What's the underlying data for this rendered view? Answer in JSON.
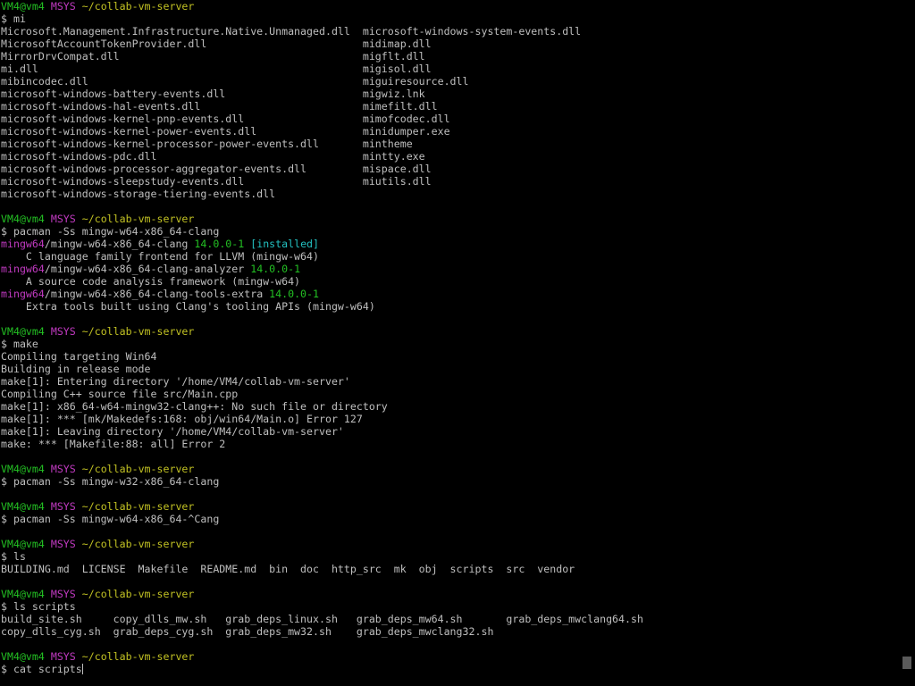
{
  "terminal": {
    "lines": [
      {
        "segs": [
          {
            "t": "VM4@vm4 ",
            "c": "user"
          },
          {
            "t": "MSYS ",
            "c": "sys"
          },
          {
            "t": "~/collab-vm-server",
            "c": "path"
          }
        ]
      },
      {
        "segs": [
          {
            "t": "$ mi",
            "c": "text"
          }
        ]
      },
      {
        "segs": [
          {
            "t": "Microsoft.Management.Infrastructure.Native.Unmanaged.dll  microsoft-windows-system-events.dll",
            "c": "text"
          }
        ]
      },
      {
        "segs": [
          {
            "t": "MicrosoftAccountTokenProvider.dll                         midimap.dll",
            "c": "text"
          }
        ]
      },
      {
        "segs": [
          {
            "t": "MirrorDrvCompat.dll                                       migflt.dll",
            "c": "text"
          }
        ]
      },
      {
        "segs": [
          {
            "t": "mi.dll                                                    migisol.dll",
            "c": "text"
          }
        ]
      },
      {
        "segs": [
          {
            "t": "mibincodec.dll                                            miguiresource.dll",
            "c": "text"
          }
        ]
      },
      {
        "segs": [
          {
            "t": "microsoft-windows-battery-events.dll                      migwiz.lnk",
            "c": "text"
          }
        ]
      },
      {
        "segs": [
          {
            "t": "microsoft-windows-hal-events.dll                          mimefilt.dll",
            "c": "text"
          }
        ]
      },
      {
        "segs": [
          {
            "t": "microsoft-windows-kernel-pnp-events.dll                   mimofcodec.dll",
            "c": "text"
          }
        ]
      },
      {
        "segs": [
          {
            "t": "microsoft-windows-kernel-power-events.dll                 minidumper.exe",
            "c": "text"
          }
        ]
      },
      {
        "segs": [
          {
            "t": "microsoft-windows-kernel-processor-power-events.dll       mintheme",
            "c": "text"
          }
        ]
      },
      {
        "segs": [
          {
            "t": "microsoft-windows-pdc.dll                                 mintty.exe",
            "c": "text"
          }
        ]
      },
      {
        "segs": [
          {
            "t": "microsoft-windows-processor-aggregator-events.dll         mispace.dll",
            "c": "text"
          }
        ]
      },
      {
        "segs": [
          {
            "t": "microsoft-windows-sleepstudy-events.dll                   miutils.dll",
            "c": "text"
          }
        ]
      },
      {
        "segs": [
          {
            "t": "microsoft-windows-storage-tiering-events.dll",
            "c": "text"
          }
        ]
      },
      {
        "segs": []
      },
      {
        "segs": [
          {
            "t": "VM4@vm4 ",
            "c": "user"
          },
          {
            "t": "MSYS ",
            "c": "sys"
          },
          {
            "t": "~/collab-vm-server",
            "c": "path"
          }
        ]
      },
      {
        "segs": [
          {
            "t": "$ pacman -Ss mingw-w64-x86_64-clang",
            "c": "text"
          }
        ]
      },
      {
        "segs": [
          {
            "t": "mingw64",
            "c": "repo"
          },
          {
            "t": "/mingw-w64-x86_64-clang ",
            "c": "text"
          },
          {
            "t": "14.0.0-1 ",
            "c": "ver"
          },
          {
            "t": "[installed]",
            "c": "inst"
          }
        ]
      },
      {
        "segs": [
          {
            "t": "    C language family frontend for LLVM (mingw-w64)",
            "c": "text"
          }
        ]
      },
      {
        "segs": [
          {
            "t": "mingw64",
            "c": "repo"
          },
          {
            "t": "/mingw-w64-x86_64-clang-analyzer ",
            "c": "text"
          },
          {
            "t": "14.0.0-1",
            "c": "ver"
          }
        ]
      },
      {
        "segs": [
          {
            "t": "    A source code analysis framework (mingw-w64)",
            "c": "text"
          }
        ]
      },
      {
        "segs": [
          {
            "t": "mingw64",
            "c": "repo"
          },
          {
            "t": "/mingw-w64-x86_64-clang-tools-extra ",
            "c": "text"
          },
          {
            "t": "14.0.0-1",
            "c": "ver"
          }
        ]
      },
      {
        "segs": [
          {
            "t": "    Extra tools built using Clang's tooling APIs (mingw-w64)",
            "c": "text"
          }
        ]
      },
      {
        "segs": []
      },
      {
        "segs": [
          {
            "t": "VM4@vm4 ",
            "c": "user"
          },
          {
            "t": "MSYS ",
            "c": "sys"
          },
          {
            "t": "~/collab-vm-server",
            "c": "path"
          }
        ]
      },
      {
        "segs": [
          {
            "t": "$ make",
            "c": "text"
          }
        ]
      },
      {
        "segs": [
          {
            "t": "Compiling targeting Win64",
            "c": "text"
          }
        ]
      },
      {
        "segs": [
          {
            "t": "Building in release mode",
            "c": "text"
          }
        ]
      },
      {
        "segs": [
          {
            "t": "make[1]: Entering directory '/home/VM4/collab-vm-server'",
            "c": "text"
          }
        ]
      },
      {
        "segs": [
          {
            "t": "Compiling C++ source file src/Main.cpp",
            "c": "text"
          }
        ]
      },
      {
        "segs": [
          {
            "t": "make[1]: x86_64-w64-mingw32-clang++: No such file or directory",
            "c": "text"
          }
        ]
      },
      {
        "segs": [
          {
            "t": "make[1]: *** [mk/Makedefs:168: obj/win64/Main.o] Error 127",
            "c": "text"
          }
        ]
      },
      {
        "segs": [
          {
            "t": "make[1]: Leaving directory '/home/VM4/collab-vm-server'",
            "c": "text"
          }
        ]
      },
      {
        "segs": [
          {
            "t": "make: *** [Makefile:88: all] Error 2",
            "c": "text"
          }
        ]
      },
      {
        "segs": []
      },
      {
        "segs": [
          {
            "t": "VM4@vm4 ",
            "c": "user"
          },
          {
            "t": "MSYS ",
            "c": "sys"
          },
          {
            "t": "~/collab-vm-server",
            "c": "path"
          }
        ]
      },
      {
        "segs": [
          {
            "t": "$ pacman -Ss mingw-w32-x86_64-clang",
            "c": "text"
          }
        ]
      },
      {
        "segs": []
      },
      {
        "segs": [
          {
            "t": "VM4@vm4 ",
            "c": "user"
          },
          {
            "t": "MSYS ",
            "c": "sys"
          },
          {
            "t": "~/collab-vm-server",
            "c": "path"
          }
        ]
      },
      {
        "segs": [
          {
            "t": "$ pacman -Ss mingw-w64-x86_64-^Cang",
            "c": "text"
          }
        ]
      },
      {
        "segs": []
      },
      {
        "segs": [
          {
            "t": "VM4@vm4 ",
            "c": "user"
          },
          {
            "t": "MSYS ",
            "c": "sys"
          },
          {
            "t": "~/collab-vm-server",
            "c": "path"
          }
        ]
      },
      {
        "segs": [
          {
            "t": "$ ls",
            "c": "text"
          }
        ]
      },
      {
        "segs": [
          {
            "t": "BUILDING.md  LICENSE  Makefile  README.md  bin  doc  http_src  mk  obj  scripts  src  vendor",
            "c": "text"
          }
        ]
      },
      {
        "segs": []
      },
      {
        "segs": [
          {
            "t": "VM4@vm4 ",
            "c": "user"
          },
          {
            "t": "MSYS ",
            "c": "sys"
          },
          {
            "t": "~/collab-vm-server",
            "c": "path"
          }
        ]
      },
      {
        "segs": [
          {
            "t": "$ ls scripts",
            "c": "text"
          }
        ]
      },
      {
        "segs": [
          {
            "t": "build_site.sh     copy_dlls_mw.sh   grab_deps_linux.sh   grab_deps_mw64.sh       grab_deps_mwclang64.sh",
            "c": "text"
          }
        ]
      },
      {
        "segs": [
          {
            "t": "copy_dlls_cyg.sh  grab_deps_cyg.sh  grab_deps_mw32.sh    grab_deps_mwclang32.sh",
            "c": "text"
          }
        ]
      },
      {
        "segs": []
      },
      {
        "segs": [
          {
            "t": "VM4@vm4 ",
            "c": "user"
          },
          {
            "t": "MSYS ",
            "c": "sys"
          },
          {
            "t": "~/collab-vm-server",
            "c": "path"
          }
        ]
      },
      {
        "segs": [
          {
            "t": "$ cat scripts",
            "c": "text"
          }
        ],
        "cursor": true
      }
    ]
  }
}
